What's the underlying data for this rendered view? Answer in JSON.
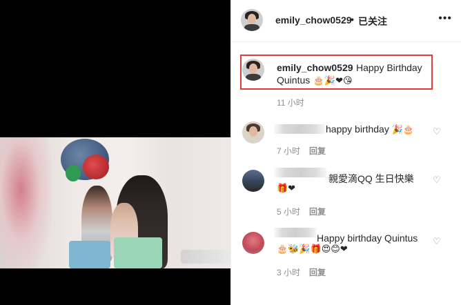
{
  "post": {
    "username": "emily_chow0529",
    "follow_status": "已关注",
    "more_icon": "more-dots-icon",
    "caption_text": "Happy Birthday",
    "caption_text2": "Quintus",
    "caption_emojis": "🎂🎉❤😘",
    "caption_time": "11 小时"
  },
  "comments": [
    {
      "text": "happy birthday",
      "emojis": "🎉🎂",
      "time": "7 小时",
      "reply": "回复"
    },
    {
      "text": "親愛滴QQ 生日快樂",
      "emojis": "🎁❤",
      "time": "5 小时",
      "reply": "回复"
    },
    {
      "text": "Happy birthday Quintus",
      "emojis": "🎂🐝🎉🎁😍😊❤",
      "time": "3 小时",
      "reply": "回复"
    }
  ],
  "colors": {
    "highlight_border": "#e33a3a",
    "meta_gray": "#8e8e8e",
    "text_dark": "#262626"
  }
}
